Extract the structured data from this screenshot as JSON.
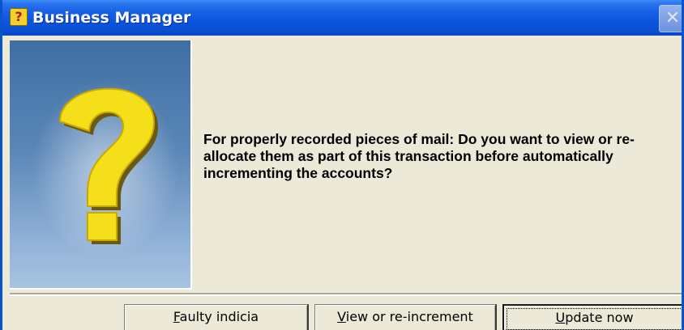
{
  "window": {
    "title": "Business Manager",
    "close_glyph": "✕"
  },
  "icon": {
    "title_icon": "question-icon",
    "title_icon_glyph": "?",
    "panel_icon": "question-mark-icon",
    "panel_gradient_top": "#3e6fa3",
    "panel_gradient_bottom": "#a8c4e2",
    "question_color": "#f5de1a"
  },
  "message": {
    "text": "For properly recorded pieces of mail: Do you want to view or re-allocate them as part of this transaction before automatically incrementing the accounts?"
  },
  "buttons": {
    "faulty": {
      "mnemonic": "F",
      "rest": "aulty indicia"
    },
    "view": {
      "mnemonic": "V",
      "rest": "iew or re-increment"
    },
    "update": {
      "mnemonic": "U",
      "rest": "pdate now"
    }
  },
  "colors": {
    "titlebar": "#0b55de",
    "dialog_bg": "#ece9d8"
  }
}
